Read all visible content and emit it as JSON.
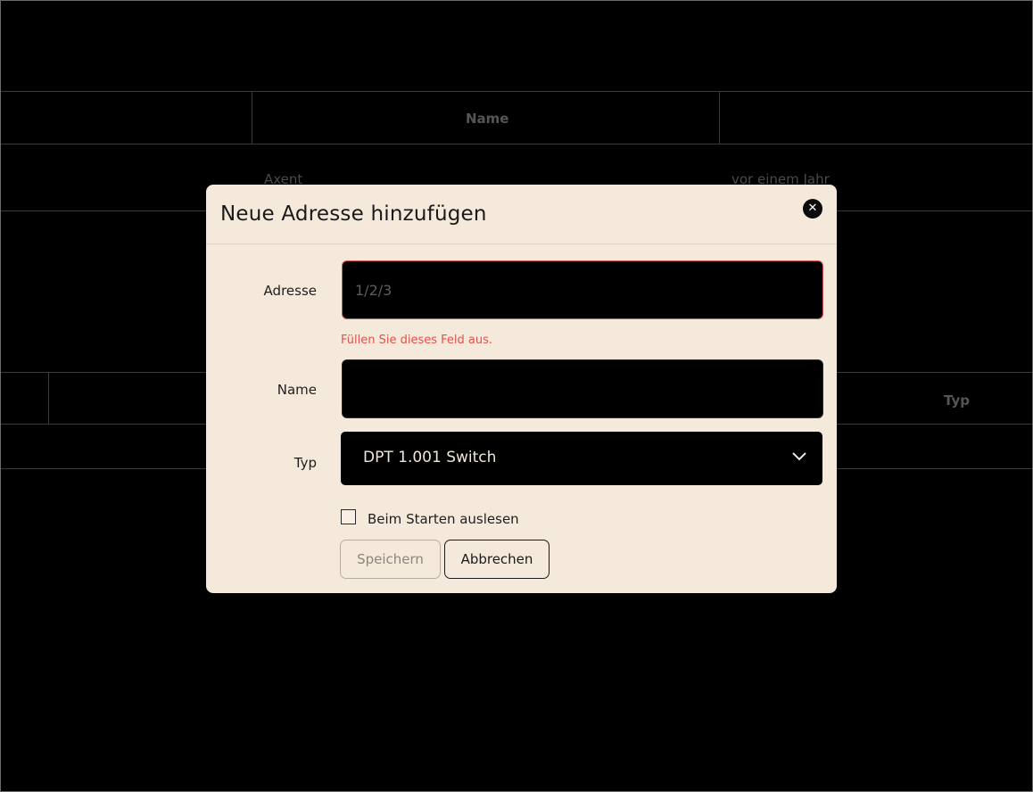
{
  "background_table": {
    "header_name": "Name",
    "row1_name": "Axent",
    "row1_time": "vor einem Jahr",
    "header_typ": "Typ"
  },
  "dialog": {
    "title": "Neue Adresse hinzufügen",
    "close_icon": "close-icon",
    "address": {
      "label": "Adresse",
      "value": "",
      "placeholder": "1/2/3",
      "error": "Füllen Sie dieses Feld aus."
    },
    "name": {
      "label": "Name",
      "value": "",
      "placeholder": ""
    },
    "type": {
      "label": "Typ",
      "selected": "DPT 1.001 Switch",
      "icon": "chevron-down-icon"
    },
    "read_on_start": {
      "label": "Beim Starten auslesen",
      "checked": false
    },
    "save_label": "Speichern",
    "cancel_label": "Abbrechen"
  },
  "colors": {
    "dialog_bg": "#f5e9db",
    "input_bg": "#000000",
    "error": "#e0524b"
  }
}
